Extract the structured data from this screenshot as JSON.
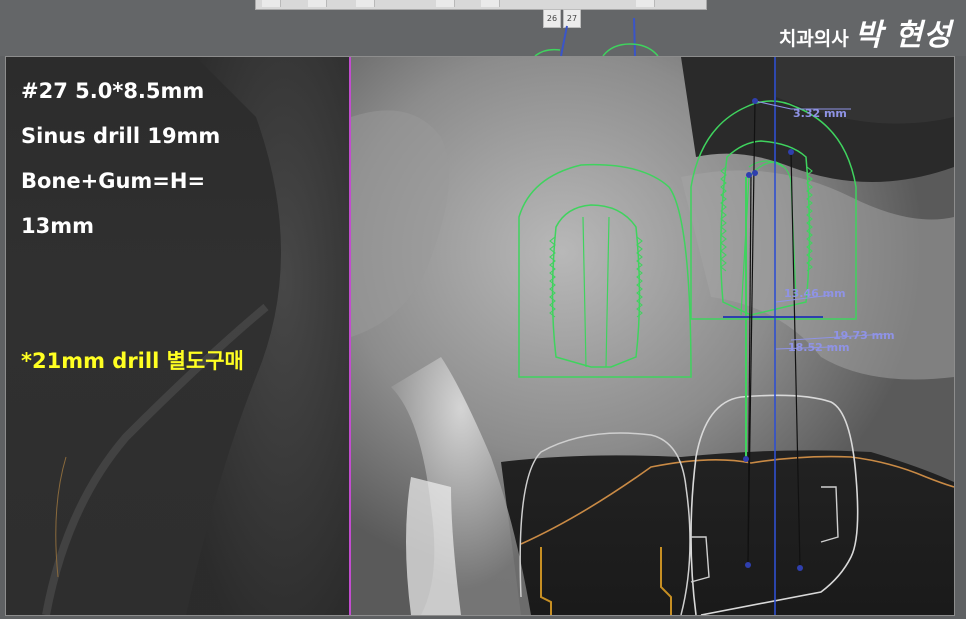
{
  "watermark": {
    "prefix": "치과의사",
    "name": "박 현성"
  },
  "tooth_tabs": [
    "26",
    "27"
  ],
  "notes": {
    "lines": [
      "#27 5.0*8.5mm",
      "Sinus drill 19mm",
      "Bone+Gum=H=",
      "13mm"
    ],
    "warning": "*21mm drill 별도구매"
  },
  "measurements": {
    "m1": "3.32 mm",
    "m2": "13.46 mm",
    "m3": "19.73 mm",
    "m4": "18.52 mm"
  },
  "colors": {
    "implant_outline": "#3fd35e",
    "measure_line": "#2f3fae",
    "gingiva_line": "#c98a45",
    "crown_outline": "#d9d9d9",
    "warning_text": "#ffff22",
    "divider": "#c24ccf"
  }
}
